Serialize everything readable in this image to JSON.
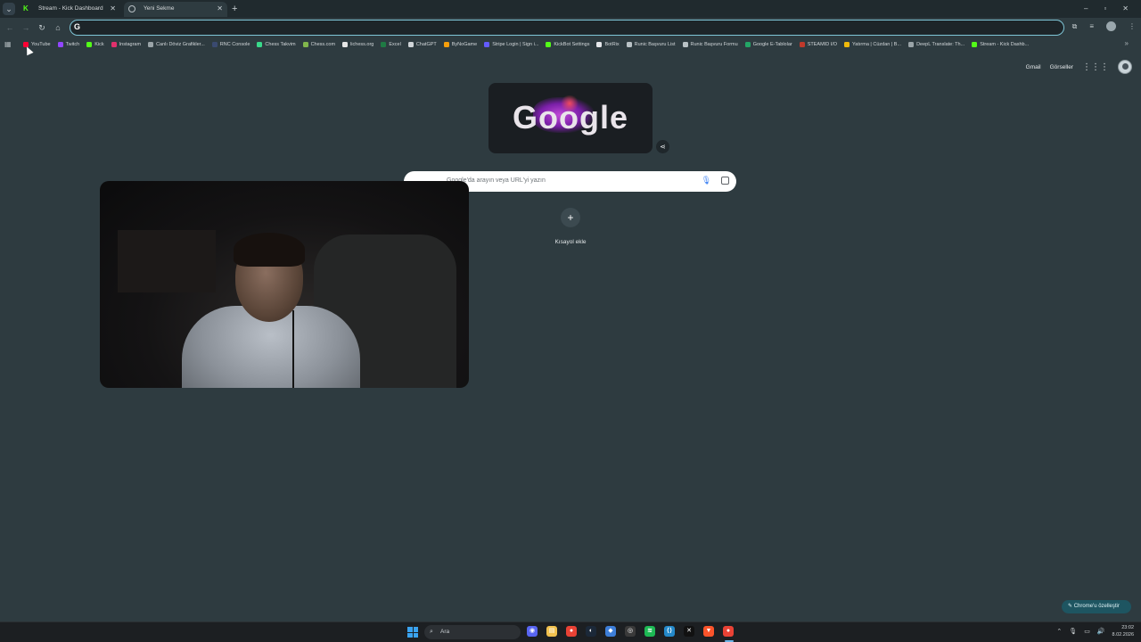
{
  "tabs": [
    {
      "label": "Stream - Kick Dashboard",
      "icon": "kick-icon"
    },
    {
      "label": "Yeni Sekme",
      "icon": "globe-icon"
    }
  ],
  "omnibox": {
    "value": "",
    "icon": "google-g-icon"
  },
  "bookmarks": [
    {
      "label": "YouTube",
      "icon": "youtube-icon",
      "color": "#ff0033"
    },
    {
      "label": "Twitch",
      "icon": "twitch-icon",
      "color": "#9146ff"
    },
    {
      "label": "Kick",
      "icon": "kick-icon",
      "color": "#53fc18"
    },
    {
      "label": "Instagram",
      "icon": "instagram-icon",
      "color": "#e1306c"
    },
    {
      "label": "Canlı Döviz Grafikler...",
      "icon": "chart-icon",
      "color": "#9aa4a8"
    },
    {
      "label": "RNC Console",
      "icon": "console-icon",
      "color": "#3a4a70"
    },
    {
      "label": "Chess Takvim",
      "icon": "chess-icon",
      "color": "#39d98a"
    },
    {
      "label": "Chess.com",
      "icon": "pawn-icon",
      "color": "#81b64c"
    },
    {
      "label": "lichess.org",
      "icon": "lichess-icon",
      "color": "#e6e6e6"
    },
    {
      "label": "Excel",
      "icon": "excel-icon",
      "color": "#1f7a44"
    },
    {
      "label": "ChatGPT",
      "icon": "chatgpt-icon",
      "color": "#cfd4d7"
    },
    {
      "label": "ByNoGame",
      "icon": "bynogame-icon",
      "color": "#f59e0b"
    },
    {
      "label": "Stripe Login | Sign i...",
      "icon": "stripe-icon",
      "color": "#635bff"
    },
    {
      "label": "KickBot Settings",
      "icon": "kickbot-icon",
      "color": "#53fc18"
    },
    {
      "label": "BotRix",
      "icon": "botrix-icon",
      "color": "#e5e7eb"
    },
    {
      "label": "Runic Başvuru List",
      "icon": "runic-icon",
      "color": "#b9c2c6"
    },
    {
      "label": "Runic Başvuru Formu",
      "icon": "runic-icon",
      "color": "#b9c2c6"
    },
    {
      "label": "Google E-Tablolar",
      "icon": "sheets-icon",
      "color": "#23a566"
    },
    {
      "label": "STEAMID I/O",
      "icon": "steamid-icon",
      "color": "#c0392b"
    },
    {
      "label": "Yatırma | Cüzdan | B...",
      "icon": "binance-icon",
      "color": "#f0b90b"
    },
    {
      "label": "DeepL Translate: Th...",
      "icon": "deepl-icon",
      "color": "#9aa4a8"
    },
    {
      "label": "Stream - Kick Dashb...",
      "icon": "kick-icon",
      "color": "#53fc18"
    }
  ],
  "ntp": {
    "gmail": "Gmail",
    "images": "Görseller",
    "doodle_text": "Google",
    "search_placeholder": "Google'da arayın veya URL'yi yazın",
    "shortcut_label": "Kısayol ekle",
    "customize_label": "Chrome'u özelleştir"
  },
  "taskbar": {
    "search_label": "Ara",
    "time": "23:02",
    "date": "8.02.2026",
    "icons": [
      {
        "name": "discord-icon",
        "color": "#5865f2",
        "glyph": "◉"
      },
      {
        "name": "file-explorer-icon",
        "color": "#f2c14e",
        "glyph": "▤"
      },
      {
        "name": "chrome-icon",
        "color": "#e94235",
        "glyph": "●"
      },
      {
        "name": "steam-icon",
        "color": "#1b2838",
        "glyph": "◐"
      },
      {
        "name": "app-icon",
        "color": "#3d7ed8",
        "glyph": "◆"
      },
      {
        "name": "obs-icon",
        "color": "#3a3a3a",
        "glyph": "◎"
      },
      {
        "name": "spotify-icon",
        "color": "#1db954",
        "glyph": "≋"
      },
      {
        "name": "vscode-icon",
        "color": "#2489ca",
        "glyph": "⟨⟩"
      },
      {
        "name": "capcut-icon",
        "color": "#111111",
        "glyph": "✕"
      },
      {
        "name": "brave-icon",
        "color": "#fb542b",
        "glyph": "▼"
      },
      {
        "name": "chrome-active-icon",
        "color": "#e94235",
        "glyph": "●"
      }
    ]
  }
}
